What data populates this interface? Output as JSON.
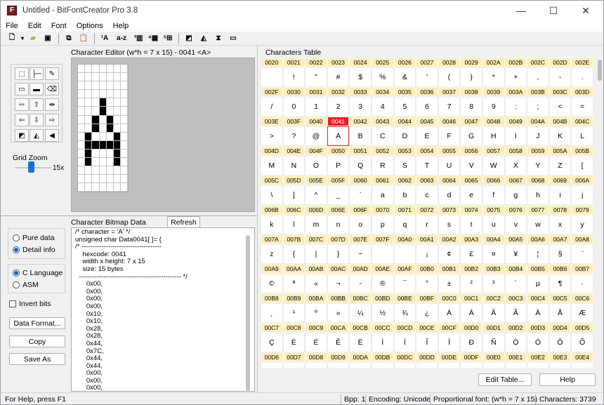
{
  "window": {
    "title": "Untitled - BitFontCreator Pro 3.8",
    "min": "—",
    "max": "☐",
    "close": "✕"
  },
  "menu": [
    "File",
    "Edit",
    "Font",
    "Options",
    "Help"
  ],
  "editor": {
    "label": "Character Editor (w*h = 7 x 15) - 0041 <A>",
    "grid_zoom_label": "Grid Zoom",
    "zoom_value": "15x",
    "bitmap": [
      "0000000",
      "0000000",
      "0000000",
      "0000000",
      "0001000",
      "0001000",
      "0010100",
      "0010100",
      "0100010",
      "0111110",
      "0100010",
      "0100010",
      "0000000",
      "0000000",
      "0000000"
    ]
  },
  "bitmap_data": {
    "label": "Character Bitmap Data",
    "refresh": "Refresh",
    "code": "/* character = 'A' */\nunsigned char Data0041[ ]= {\n/* ------------------------------------\n    hexcode: 0041\n    width x height: 7 x 15\n    size: 15 bytes\n  ---------------------------------------------- */\n      0x00,\n      0x00,\n      0x00,\n      0x00,\n      0x10,\n      0x10,\n      0x28,\n      0x28,\n      0x44,\n      0x7C,\n      0x44,\n      0x44,\n      0x00,\n      0x00,\n      0x00,"
  },
  "options": {
    "pure_data": "Pure data",
    "detail_info": "Detail info",
    "c_language": "C Language",
    "asm": "ASM",
    "invert_bits": "Invert bits",
    "data_format": "Data Format...",
    "copy": "Copy",
    "save_as": "Save As"
  },
  "char_table": {
    "label": "Characters Table",
    "rows": [
      {
        "codes": [
          "0020",
          "0021",
          "0022",
          "0023",
          "0024",
          "0025",
          "0026",
          "0027",
          "0028",
          "0029",
          "002A",
          "002B",
          "002C",
          "002D",
          "002E"
        ],
        "chars": [
          "",
          " !",
          "\"",
          "#",
          "$",
          "%",
          "&",
          "'",
          "(",
          ")",
          "*",
          "+",
          ",",
          "-",
          "."
        ]
      },
      {
        "codes": [
          "002F",
          "0030",
          "0031",
          "0032",
          "0033",
          "0034",
          "0035",
          "0036",
          "0037",
          "0038",
          "0039",
          "003A",
          "003B",
          "003C",
          "003D"
        ],
        "chars": [
          "/",
          "0",
          "1",
          "2",
          "3",
          "4",
          "5",
          "6",
          "7",
          "8",
          "9",
          ":",
          ";",
          "<",
          "="
        ]
      },
      {
        "codes": [
          "003E",
          "003F",
          "0040",
          "0041",
          "0042",
          "0043",
          "0044",
          "0045",
          "0046",
          "0047",
          "0048",
          "0049",
          "004A",
          "004B",
          "004C"
        ],
        "chars": [
          ">",
          "?",
          "@",
          "A",
          "B",
          "C",
          "D",
          "E",
          "F",
          "G",
          "H",
          "I",
          "J",
          "K",
          "L"
        ]
      },
      {
        "codes": [
          "004D",
          "004E",
          "004F",
          "0050",
          "0051",
          "0052",
          "0053",
          "0054",
          "0055",
          "0056",
          "0057",
          "0058",
          "0059",
          "005A",
          "005B"
        ],
        "chars": [
          "M",
          "N",
          "O",
          "P",
          "Q",
          "R",
          "S",
          "T",
          "U",
          "V",
          "W",
          "X",
          "Y",
          "Z",
          "["
        ]
      },
      {
        "codes": [
          "005C",
          "005D",
          "005E",
          "005F",
          "0060",
          "0061",
          "0062",
          "0063",
          "0064",
          "0065",
          "0066",
          "0067",
          "0068",
          "0069",
          "006A"
        ],
        "chars": [
          "\\",
          "]",
          "^",
          "_",
          "`",
          "a",
          "b",
          "c",
          "d",
          "e",
          "f",
          "g",
          "h",
          "i",
          "j"
        ]
      },
      {
        "codes": [
          "006B",
          "006C",
          "006D",
          "006E",
          "006F",
          "0070",
          "0071",
          "0072",
          "0073",
          "0074",
          "0075",
          "0076",
          "0077",
          "0078",
          "0079"
        ],
        "chars": [
          "k",
          "l",
          "m",
          "n",
          "o",
          "p",
          "q",
          "r",
          "s",
          "t",
          "u",
          "v",
          "w",
          "x",
          "y"
        ]
      },
      {
        "codes": [
          "007A",
          "007B",
          "007C",
          "007D",
          "007E",
          "007F",
          "00A0",
          "00A1",
          "00A2",
          "00A3",
          "00A4",
          "00A5",
          "00A6",
          "00A7",
          "00A8"
        ],
        "chars": [
          "z",
          "{",
          "|",
          "}",
          "~",
          "",
          "",
          "¡",
          "¢",
          "£",
          "¤",
          "¥",
          "¦",
          "§",
          "¨"
        ]
      },
      {
        "codes": [
          "00A9",
          "00AA",
          "00AB",
          "00AC",
          "00AD",
          "00AE",
          "00AF",
          "00B0",
          "00B1",
          "00B2",
          "00B3",
          "00B4",
          "00B5",
          "00B6",
          "00B7"
        ],
        "chars": [
          "©",
          "ª",
          "«",
          "¬",
          "-",
          "®",
          "¯",
          "°",
          "±",
          "²",
          "³",
          "´",
          "µ",
          "¶",
          "·"
        ]
      },
      {
        "codes": [
          "00B8",
          "00B9",
          "00BA",
          "00BB",
          "00BC",
          "00BD",
          "00BE",
          "00BF",
          "00C0",
          "00C1",
          "00C2",
          "00C3",
          "00C4",
          "00C5",
          "00C6"
        ],
        "chars": [
          "¸",
          "¹",
          "º",
          "»",
          "¼",
          "½",
          "¾",
          "¿",
          "À",
          "Á",
          "Â",
          "Ã",
          "Ä",
          "Å",
          "Æ"
        ]
      },
      {
        "codes": [
          "00C7",
          "00C8",
          "00C9",
          "00CA",
          "00CB",
          "00CC",
          "00CD",
          "00CE",
          "00CF",
          "00D0",
          "00D1",
          "00D2",
          "00D3",
          "00D4",
          "00D5"
        ],
        "chars": [
          "Ç",
          "È",
          "É",
          "Ê",
          "Ë",
          "Ì",
          "Í",
          "Î",
          "Ï",
          "Ð",
          "Ñ",
          "Ò",
          "Ó",
          "Ô",
          "Õ"
        ]
      },
      {
        "codes": [
          "00D6",
          "00D7",
          "00D8",
          "00D9",
          "00DA",
          "00DB",
          "00DC",
          "00DD",
          "00DE",
          "00DF",
          "00E0",
          "00E1",
          "00E2",
          "00E3",
          "00E4"
        ],
        "chars": [
          "",
          "",
          "",
          "",
          "",
          "",
          "",
          "",
          "",
          "",
          "",
          "",
          "",
          "",
          ""
        ]
      }
    ],
    "selected_code": "0041",
    "edit_table": "Edit Table...",
    "help": "Help"
  },
  "status": {
    "help_text": "For Help, press F1",
    "bpp": "Bpp: 1",
    "encoding": "Encoding: Unicode",
    "font_type": "Proportional font: (w*h = 7 x 15)",
    "characters": "Characters: 3739"
  },
  "colors": {
    "selected_header": "#ec1c24",
    "header_bg": "#fdeeb8",
    "accent": "#1a5fb4"
  }
}
